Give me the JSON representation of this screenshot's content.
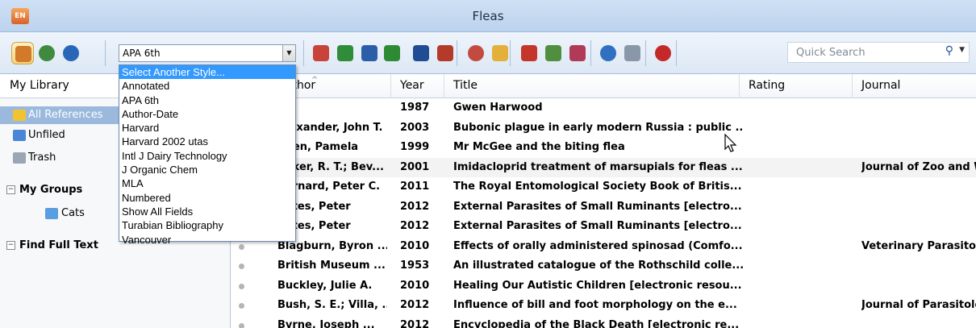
{
  "window": {
    "title": "Fleas",
    "app_icon_text": "EN"
  },
  "toolbar": {
    "style_value": "APA 6th",
    "quick_search_placeholder": "Quick Search",
    "buttons": [
      {
        "name": "local-library-mode-button",
        "color": "#d07a2a"
      },
      {
        "name": "online-search-mode-button",
        "color": "#3f8a3f"
      },
      {
        "name": "integrated-library-mode-button",
        "color": "#2a66b8"
      },
      {
        "name": "import-pdf-button",
        "color": "#c8443a"
      },
      {
        "name": "new-reference-button",
        "color": "#2f8d3a"
      },
      {
        "name": "find-full-text-button",
        "color": "#2b5ea8"
      },
      {
        "name": "insert-citation-button",
        "color": "#2f8a34"
      },
      {
        "name": "go-to-word-button",
        "color": "#1f4c93"
      },
      {
        "name": "format-bibliography-button",
        "color": "#b43a2a"
      },
      {
        "name": "online-search-button",
        "color": "#c24a3f"
      },
      {
        "name": "open-folder-button",
        "color": "#e3b13b"
      },
      {
        "name": "open-pdf-button",
        "color": "#c4352b"
      },
      {
        "name": "annotate-button",
        "color": "#4f8f3f"
      },
      {
        "name": "edit-pdf-button",
        "color": "#b03a57"
      },
      {
        "name": "sync-button",
        "color": "#2f70c0"
      },
      {
        "name": "share-library-button",
        "color": "#8a97a8"
      },
      {
        "name": "help-button",
        "color": "#c42828"
      }
    ]
  },
  "style_menu": {
    "items": [
      "Select Another Style...",
      "Annotated",
      "APA 6th",
      "Author-Date",
      "Harvard",
      "Harvard 2002 utas",
      "Intl J Dairy Technology",
      "J Organic Chem",
      "MLA",
      "Numbered",
      "Show All Fields",
      "Turabian Bibliography",
      "Vancouver"
    ]
  },
  "sidebar": {
    "header": "My Library",
    "all_references": "All References",
    "unfiled": "Unfiled",
    "trash": "Trash",
    "my_groups": "My Groups",
    "cats": "Cats",
    "find_full_text": "Find Full Text"
  },
  "table": {
    "columns": {
      "author": "Author",
      "year": "Year",
      "title": "Title",
      "rating": "Rating",
      "journal": "Journal"
    },
    "rows": [
      {
        "author": "",
        "year": "1987",
        "title": "Gwen Harwood",
        "journal": ""
      },
      {
        "author": "Alexander, John T.",
        "year": "2003",
        "title": "Bubonic plague in early modern Russia : public ...",
        "journal": ""
      },
      {
        "author": "Allen, Pamela",
        "year": "1999",
        "title": "Mr McGee and the biting flea",
        "journal": ""
      },
      {
        "author": "Baker, R. T.; Bev...",
        "year": "2001",
        "title": "Imidacloprid treatment of marsupials for fleas ...",
        "journal": "Journal of Zoo and W"
      },
      {
        "author": "Barnard, Peter C.",
        "year": "2011",
        "title": "The Royal Entomological Society Book of Britis...",
        "journal": ""
      },
      {
        "author": "Bates, Peter",
        "year": "2012",
        "title": "External Parasites of Small Ruminants [electro...",
        "journal": ""
      },
      {
        "author": "Bates, Peter",
        "year": "2012",
        "title": "External Parasites of Small Ruminants [electro...",
        "journal": ""
      },
      {
        "author": "Blagburn, Byron ...",
        "year": "2010",
        "title": "Effects of orally administered spinosad (Comfo...",
        "journal": "Veterinary Parasitolo"
      },
      {
        "author": "British Museum ...",
        "year": "1953",
        "title": "An illustrated catalogue of the Rothschild colle...",
        "journal": ""
      },
      {
        "author": "Buckley, Julie A.",
        "year": "2010",
        "title": "Healing Our Autistic Children [electronic resou...",
        "journal": ""
      },
      {
        "author": "Bush, S. E.; Villa, ...",
        "year": "2012",
        "title": "Influence of bill and foot morphology on the e...",
        "journal": "Journal of Parasitolo"
      },
      {
        "author": "Byrne, Joseph ...",
        "year": "2012",
        "title": "Encyclopedia of the Black Death [electronic re...",
        "journal": ""
      }
    ]
  }
}
